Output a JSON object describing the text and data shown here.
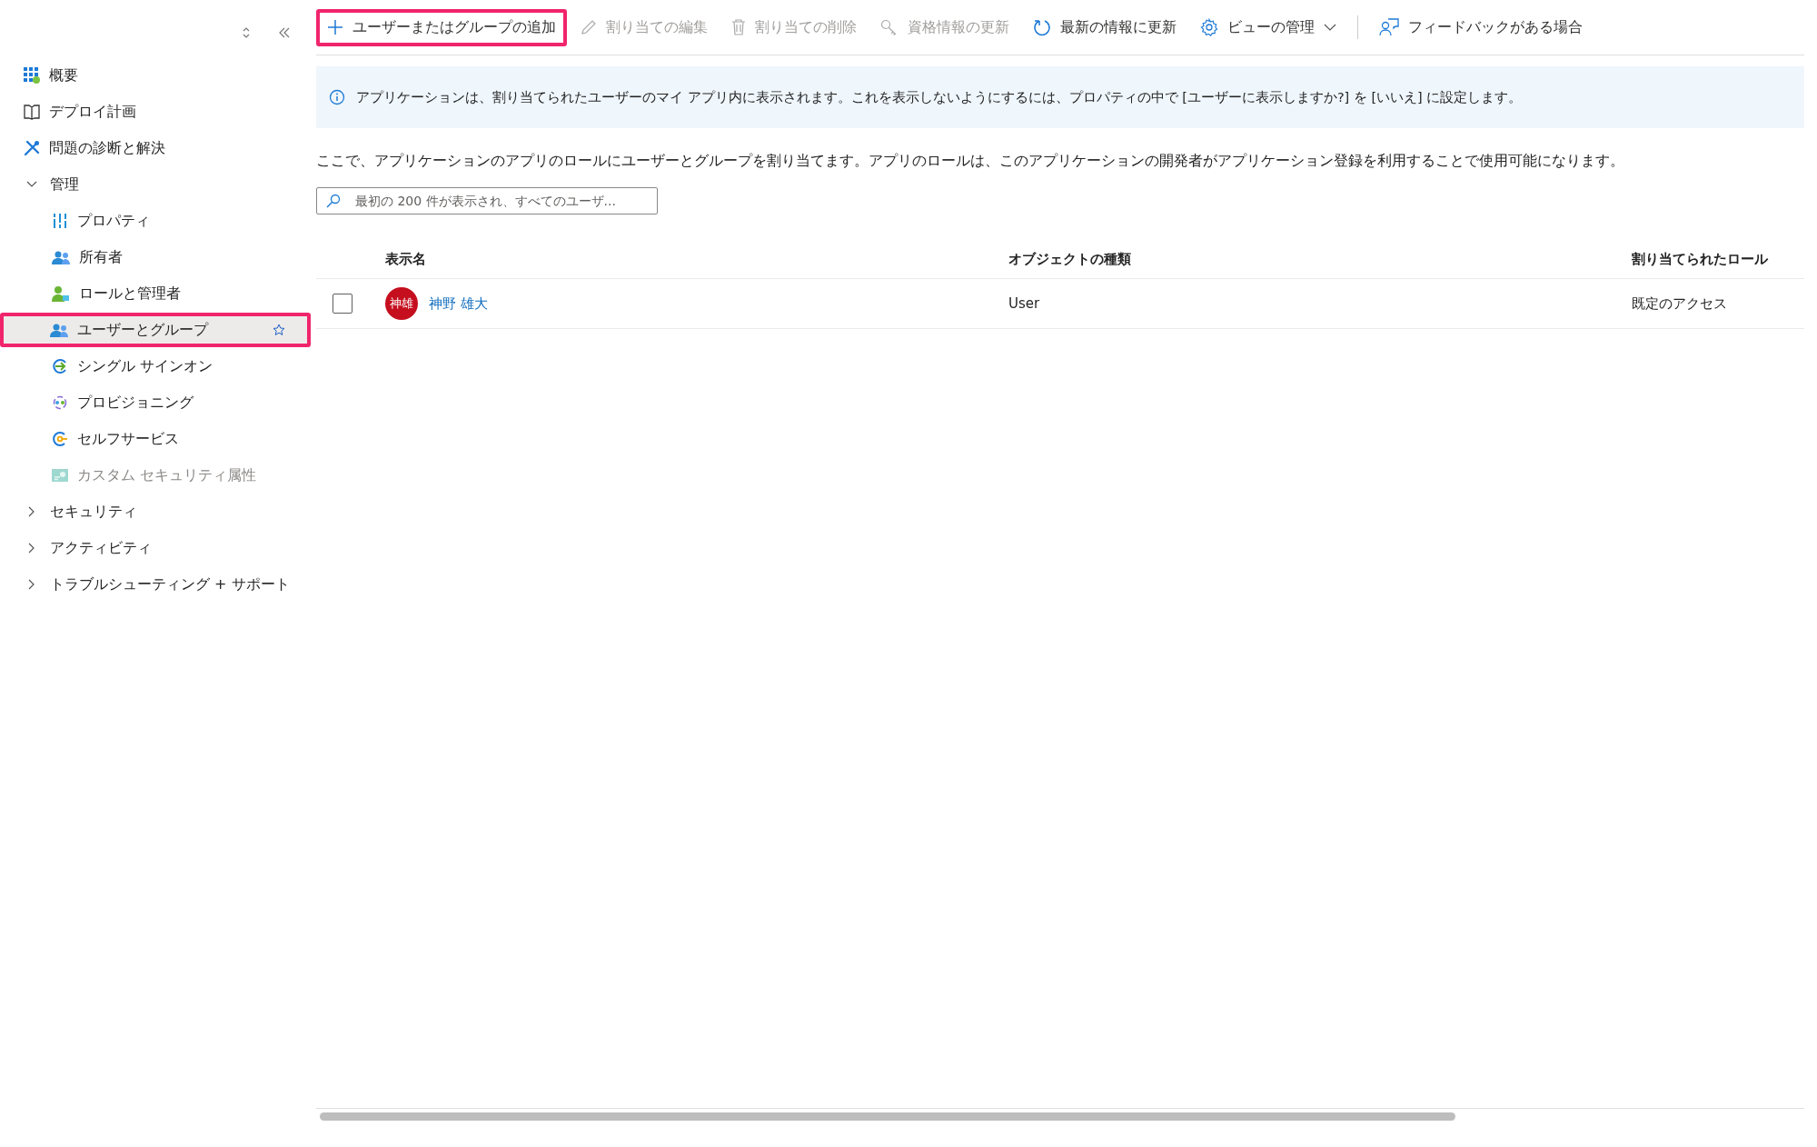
{
  "sidebar": {
    "items": [
      {
        "label": "概要",
        "selected": false,
        "disabled": false
      },
      {
        "label": "デプロイ計画",
        "selected": false,
        "disabled": false
      },
      {
        "label": "問題の診断と解決",
        "selected": false,
        "disabled": false
      },
      {
        "label": "管理",
        "expanded": true,
        "children": [
          {
            "label": "プロパティ",
            "selected": false,
            "disabled": false,
            "highlighted": false
          },
          {
            "label": "所有者",
            "selected": false,
            "disabled": false,
            "highlighted": false
          },
          {
            "label": "ロールと管理者",
            "selected": false,
            "disabled": false,
            "highlighted": false
          },
          {
            "label": "ユーザーとグループ",
            "selected": true,
            "disabled": false,
            "highlighted": true
          },
          {
            "label": "シングル サインオン",
            "selected": false,
            "disabled": false,
            "highlighted": false
          },
          {
            "label": "プロビジョニング",
            "selected": false,
            "disabled": false,
            "highlighted": false
          },
          {
            "label": "セルフサービス",
            "selected": false,
            "disabled": false,
            "highlighted": false
          },
          {
            "label": "カスタム セキュリティ属性",
            "selected": false,
            "disabled": true,
            "highlighted": false
          }
        ]
      },
      {
        "label": "セキュリティ",
        "expanded": false
      },
      {
        "label": "アクティビティ",
        "expanded": false
      },
      {
        "label": "トラブルシューティング + サポート",
        "expanded": false
      }
    ]
  },
  "toolbar": [
    {
      "label": "ユーザーまたはグループの追加",
      "disabled": false,
      "highlighted": true
    },
    {
      "label": "割り当ての編集",
      "disabled": true,
      "highlighted": false
    },
    {
      "label": "割り当ての削除",
      "disabled": true,
      "highlighted": false
    },
    {
      "label": "資格情報の更新",
      "disabled": true,
      "highlighted": false
    },
    {
      "label": "最新の情報に更新",
      "disabled": false,
      "highlighted": false
    },
    {
      "label": "ビューの管理",
      "disabled": false,
      "highlighted": false,
      "dropdown": true
    },
    {
      "label": "フィードバックがある場合",
      "disabled": false,
      "highlighted": false,
      "dropdown": false
    }
  ],
  "info_banner": "アプリケーションは、割り当てられたユーザーのマイ アプリ内に表示されます。これを表示しないようにするには、プロパティの中で [ユーザーに表示しますか?] を [いいえ] に設定します。",
  "description": "ここで、アプリケーションのアプリのロールにユーザーとグループを割り当てます。アプリのロールは、このアプリケーションの開発者がアプリケーション登録を利用することで使用可能になります。",
  "search": {
    "placeholder": "最初の 200 件が表示され、すべてのユーザ..."
  },
  "table": {
    "columns": [
      "表示名",
      "オブジェクトの種類",
      "割り当てられたロール"
    ],
    "rows": [
      {
        "checked": false,
        "avatar": "神雄",
        "name": "神野 雄大",
        "type": "User",
        "role": "既定のアクセス"
      }
    ]
  }
}
